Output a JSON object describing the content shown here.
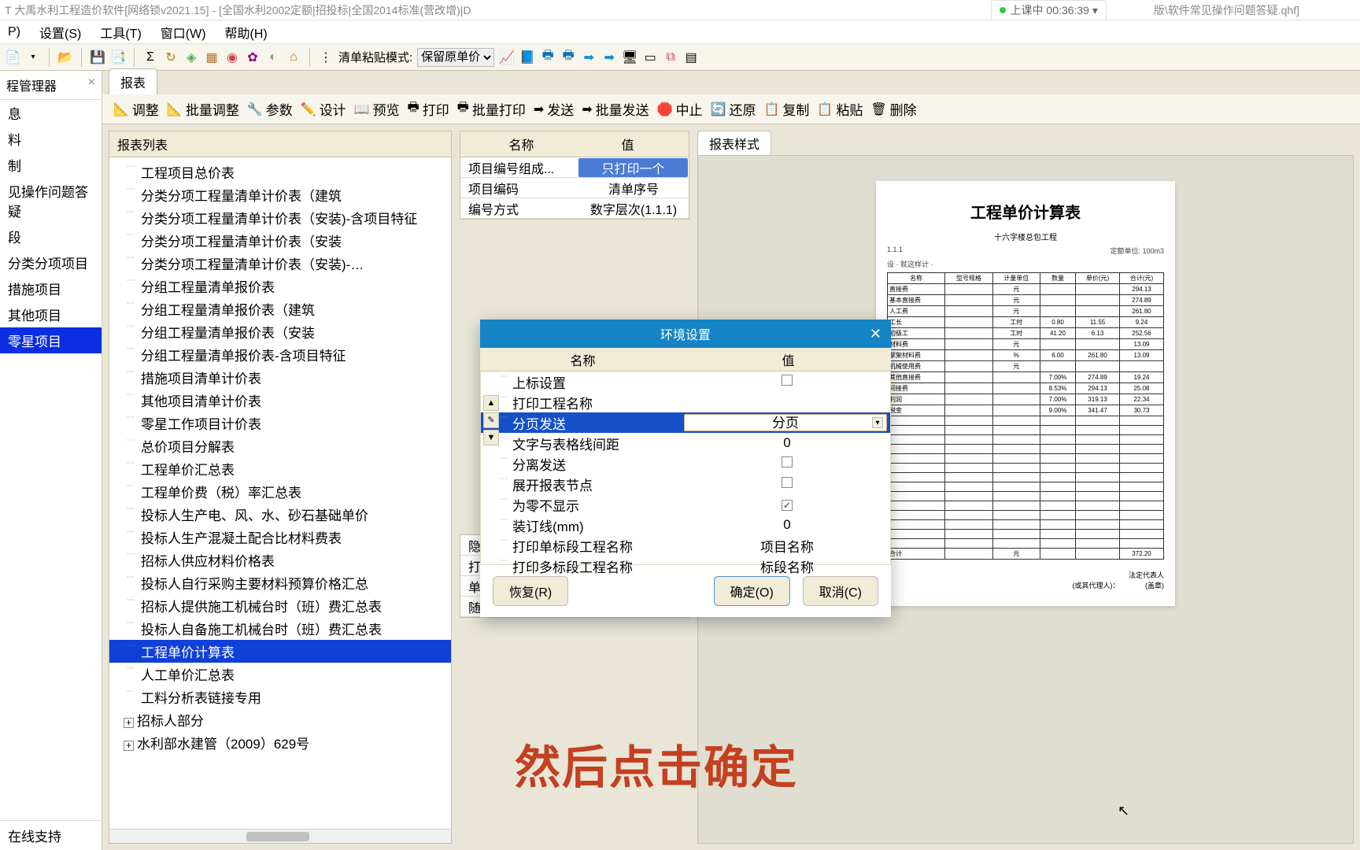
{
  "title_bar": {
    "left": "T 大禹水利工程造价软件[网络锁v2021.15] - [全国水利2002定额|招投标|全国2014标准(营改增)|D",
    "badge": "上课中 00:36:39 ▾",
    "right": "版\\软件常见操作问题答疑.qhf]"
  },
  "menu": [
    "P)",
    "设置(S)",
    "工具(T)",
    "窗口(W)",
    "帮助(H)"
  ],
  "toolbar": {
    "paste_label": "清单粘贴模式:",
    "paste_value": "保留原单价"
  },
  "sidebar": {
    "header": "程管理器",
    "items": [
      "息",
      "料",
      "制",
      "见操作问题答疑",
      "段",
      "分类分项项目",
      "措施项目",
      "其他项目",
      "零星项目"
    ],
    "selected_index": 8,
    "bottom": "在线支持"
  },
  "main_tab": "报表",
  "action_toolbar": [
    "调整",
    "批量调整",
    "参数",
    "设计",
    "预览",
    "打印",
    "批量打印",
    "发送",
    "批量发送",
    "中止",
    "还原",
    "复制",
    "粘贴",
    "删除"
  ],
  "left_panel_header": "报表列表",
  "tree": {
    "items": [
      "工程项目总价表",
      "分类分项工程量清单计价表（建筑",
      "分类分项工程量清单计价表（安装)-含项目特征",
      "分类分项工程量清单计价表（安装",
      "分类分项工程量清单计价表（安装)-…",
      "分组工程量清单报价表",
      "分组工程量清单报价表（建筑",
      "分组工程量清单报价表（安装",
      "分组工程量清单报价表-含项目特征",
      "措施项目清单计价表",
      "其他项目清单计价表",
      "零星工作项目计价表",
      "总价项目分解表",
      "工程单价汇总表",
      "工程单价费（税）率汇总表",
      "投标人生产电、风、水、砂石基础单价",
      "投标人生产混凝土配合比材料费表",
      "招标人供应材料价格表",
      "投标人自行采购主要材料预算价格汇总",
      "招标人提供施工机械台时（班）费汇总表",
      "投标人自备施工机械台时（班）费汇总表",
      "工程单价计算表",
      "人工单价汇总表",
      "工料分析表链接专用"
    ],
    "selected_index": 21,
    "groups": [
      "招标人部分",
      "水利部水建管（2009）629号"
    ]
  },
  "mid_panel": {
    "headers": [
      "名称",
      "值"
    ],
    "rows": [
      {
        "k": "项目编号组成...",
        "v": "只打印一个",
        "hilite": true
      },
      {
        "k": "项目编码",
        "v": "清单序号"
      },
      {
        "k": "编号方式",
        "v": "数字层次(1.1.1)"
      }
    ],
    "rows2": [
      {
        "k": "隐藏换算信息",
        "chk": true
      },
      {
        "k": "打印人材机明细",
        "chk": true
      },
      {
        "k": "单价编制",
        "chk": false
      },
      {
        "k": "随机排序",
        "chk": false
      }
    ]
  },
  "preview_tab": "报表样式",
  "report": {
    "title": "工程单价计算表",
    "sub": "十六字楼总包工程",
    "meta_left": "1.1.1",
    "meta_right": "定额单位: 100m3",
    "meta_note": "设 · 就这样计 ·",
    "cols": [
      "名称",
      "型号规格",
      "计量单位",
      "数量",
      "单价(元)",
      "合计(元)"
    ],
    "rows": [
      {
        "n": "直接费",
        "u": "元",
        "t": "294.13"
      },
      {
        "n": "基本直接费",
        "u": "元",
        "t": "274.89"
      },
      {
        "n": "  人工费",
        "u": "元",
        "t": "261.80"
      },
      {
        "n": "    工长",
        "u": "工时",
        "q": "0.80",
        "p": "11.55",
        "t": "9.24"
      },
      {
        "n": "    初级工",
        "u": "工时",
        "q": "41.20",
        "p": "6.13",
        "t": "252.56"
      },
      {
        "n": "  材料费",
        "u": "元",
        "t": "13.09"
      },
      {
        "n": "    掌架材料费",
        "u": "%",
        "q": "6.00",
        "p": "261.80",
        "t": "13.09"
      },
      {
        "n": "  机械使用费",
        "u": "元",
        "t": ""
      },
      {
        "n": "其他直接费",
        "t": "",
        "p": "274.89",
        "q": "7.00%",
        "u": "",
        "t2": "19.24"
      },
      {
        "n": "间接费",
        "q": "8.53%",
        "p": "294.13",
        "t": "25.08"
      },
      {
        "n": "利润",
        "q": "7.00%",
        "p": "319.13",
        "t": "22.34"
      },
      {
        "n": "税金",
        "q": "9.00%",
        "p": "341.47",
        "t": "30.73"
      }
    ],
    "sum_label": "合计",
    "sum_unit": "元",
    "sum_val": "372.20",
    "sign1": "法定代表人",
    "sign2": "(或其代理人)：",
    "sign3": "(盖章)"
  },
  "dialog": {
    "title": "环境设置",
    "headers": [
      "名称",
      "值"
    ],
    "rows": [
      {
        "k": "上标设置",
        "type": "chk",
        "v": false
      },
      {
        "k": "打印工程名称",
        "type": "text",
        "v": ""
      },
      {
        "k": "分页发送",
        "type": "select",
        "v": "分页",
        "sel": true
      },
      {
        "k": "文字与表格线间距",
        "type": "text",
        "v": "0"
      },
      {
        "k": "分离发送",
        "type": "chk",
        "v": false
      },
      {
        "k": "展开报表节点",
        "type": "chk",
        "v": false
      },
      {
        "k": "为零不显示",
        "type": "chk",
        "v": true
      },
      {
        "k": "装订线(mm)",
        "type": "text",
        "v": "0"
      },
      {
        "k": "打印单标段工程名称",
        "type": "text",
        "v": "项目名称"
      },
      {
        "k": "打印多标段工程名称",
        "type": "text",
        "v": "标段名称"
      }
    ],
    "restore": "恢复(R)",
    "ok_label": "确定(O)",
    "cancel": "取消(C)"
  },
  "caption": "然后点击确定"
}
